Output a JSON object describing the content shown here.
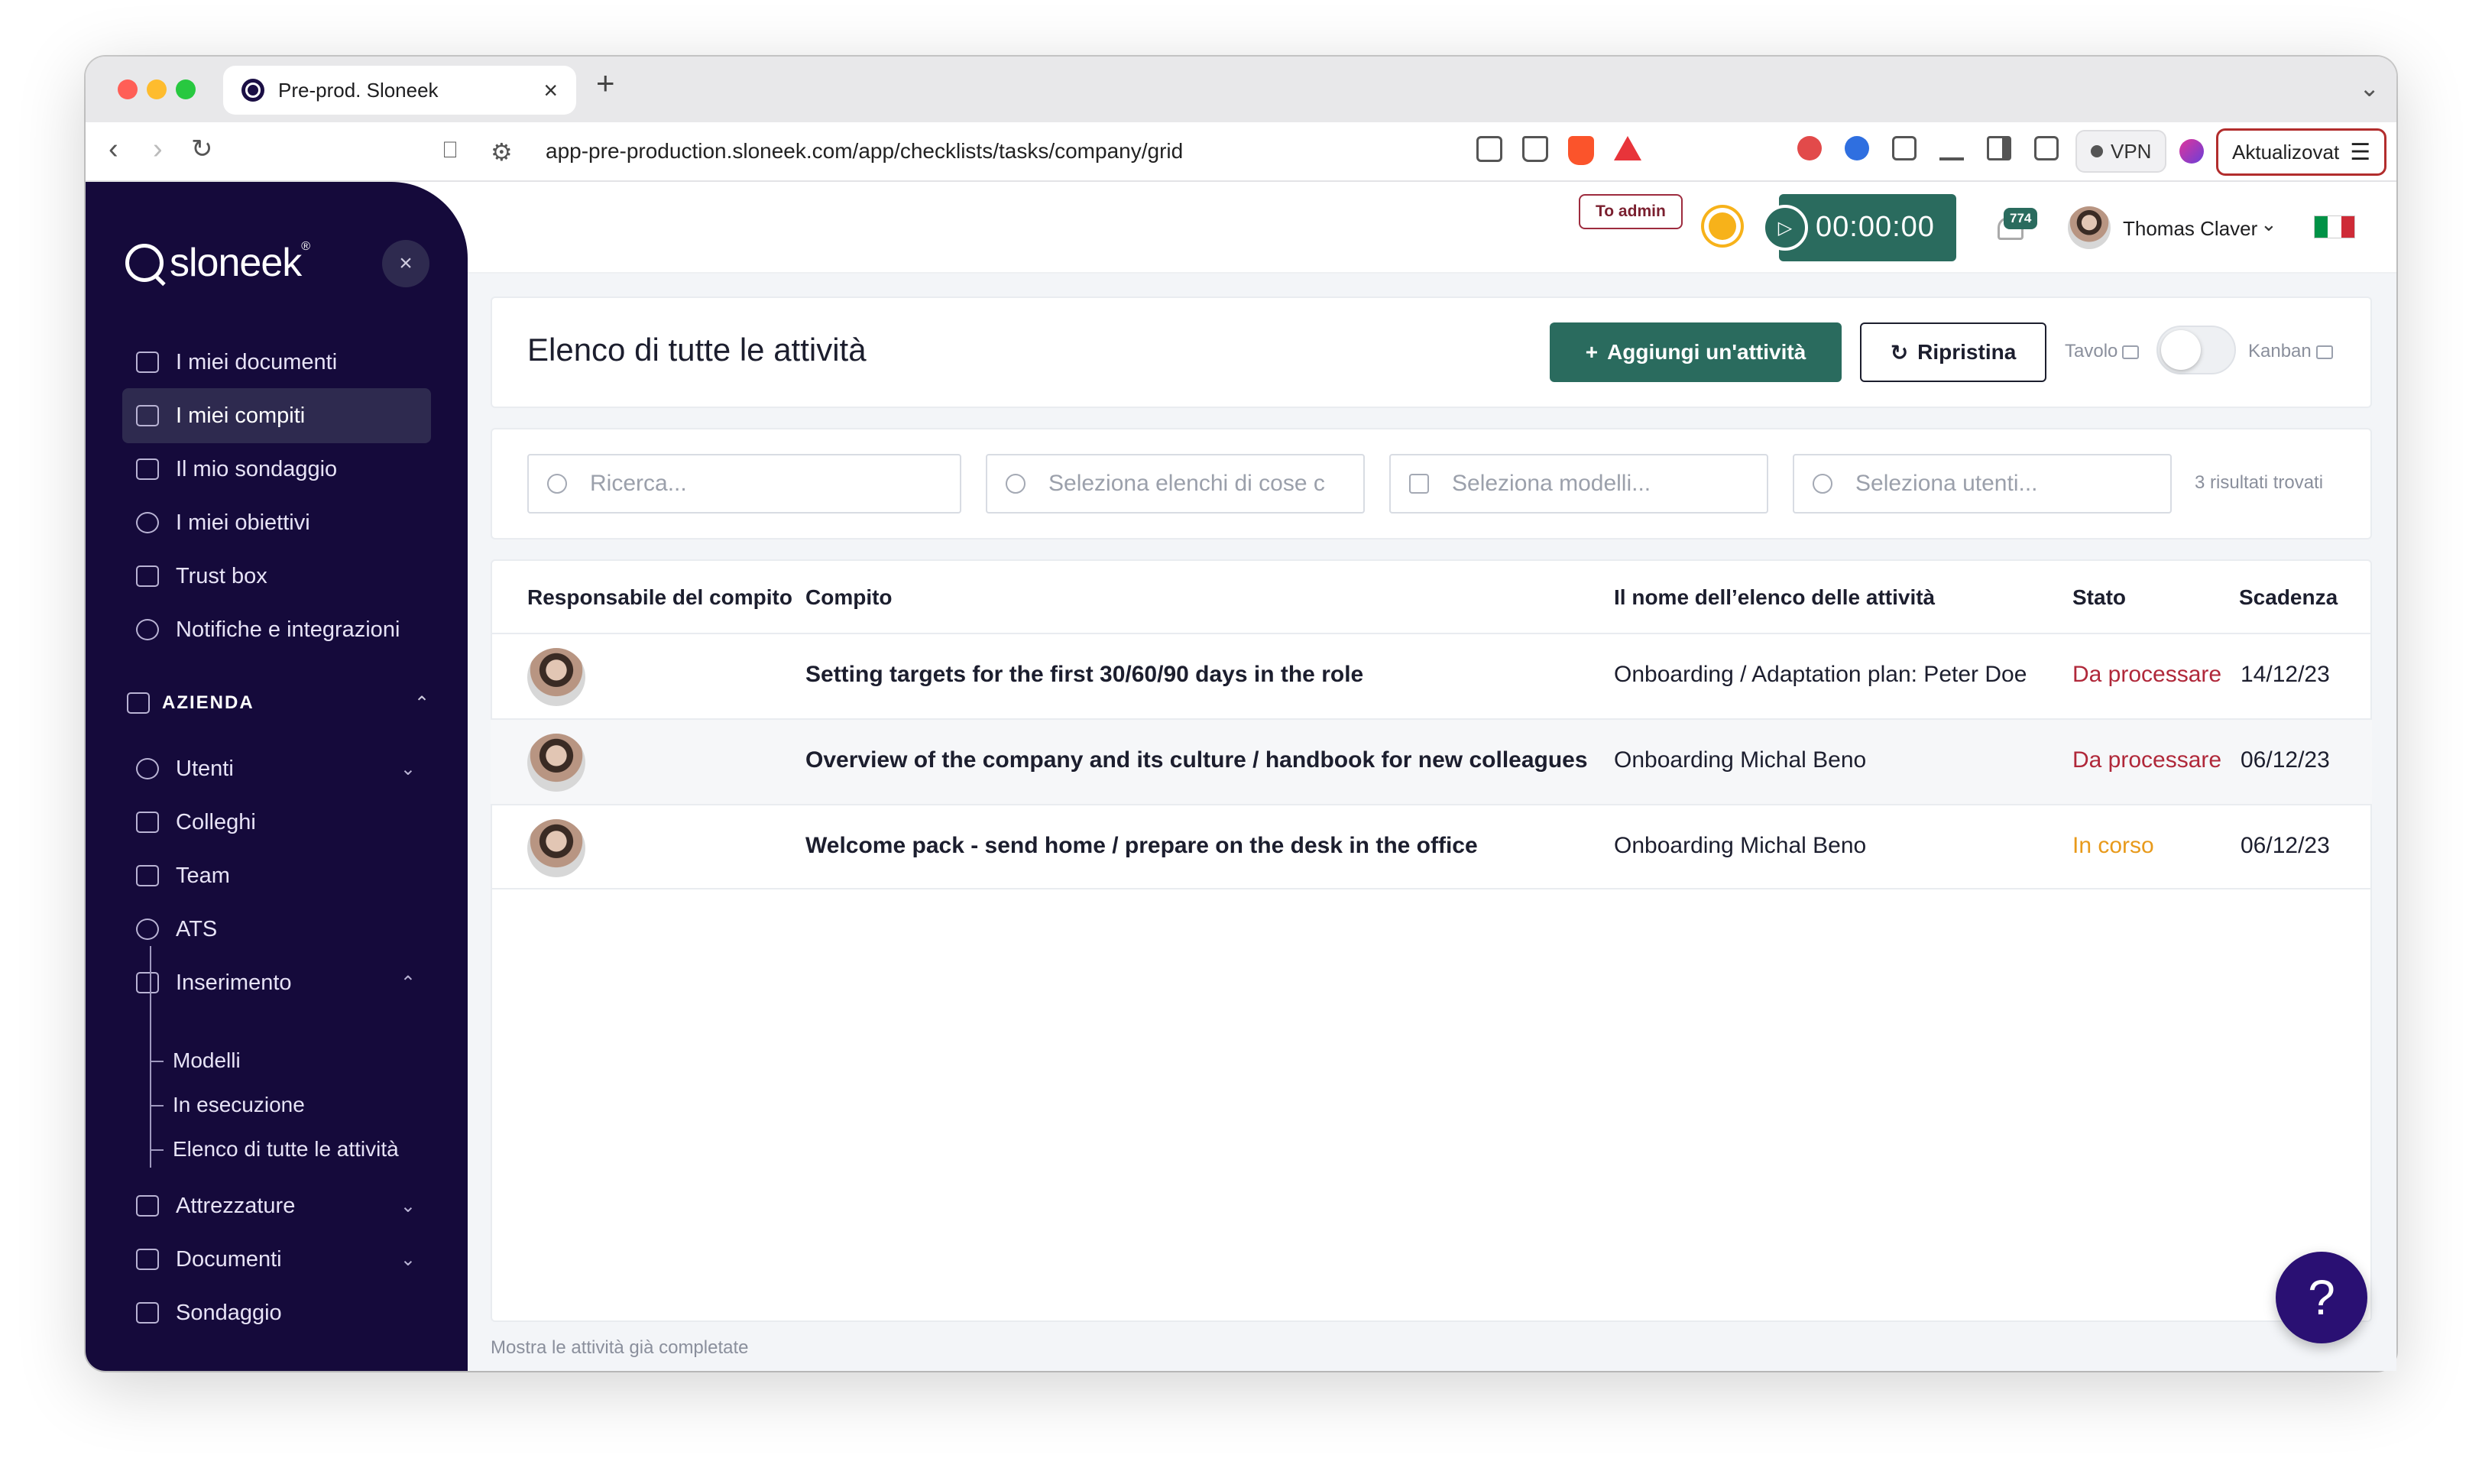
{
  "browser": {
    "tab_title": "Pre-prod. Sloneek",
    "url": "app-pre-production.sloneek.com/app/checklists/tasks/company/grid",
    "vpn_label": "VPN",
    "update_label": "Aktualizovat"
  },
  "sidebar": {
    "logo_text": "sloneek",
    "logo_mark": "®",
    "close_icon": "×",
    "items": [
      {
        "label": "I miei documenti",
        "icon": "folder-icon"
      },
      {
        "label": "I miei compiti",
        "icon": "checklist-icon",
        "active": true
      },
      {
        "label": "Il mio sondaggio",
        "icon": "survey-icon"
      },
      {
        "label": "I miei obiettivi",
        "icon": "target-icon"
      },
      {
        "label": "Trust box",
        "icon": "trust-box-icon"
      },
      {
        "label": "Notifiche e integrazioni",
        "icon": "gear-icon"
      }
    ],
    "section_label": "AZIENDA",
    "company_items": [
      {
        "label": "Utenti",
        "icon": "users-icon"
      },
      {
        "label": "Colleghi",
        "icon": "colleagues-icon"
      },
      {
        "label": "Team",
        "icon": "team-icon"
      },
      {
        "label": "ATS",
        "icon": "add-person-icon"
      },
      {
        "label": "Inserimento",
        "icon": "checklist-icon"
      }
    ],
    "sub_items": [
      "Modelli",
      "In esecuzione",
      "Elenco di tutte le attività"
    ],
    "bottom_items": [
      {
        "label": "Attrezzature",
        "icon": "tools-icon"
      },
      {
        "label": "Documenti",
        "icon": "folder-icon"
      },
      {
        "label": "Sondaggio",
        "icon": "survey-icon"
      }
    ]
  },
  "header": {
    "to_admin": "To admin",
    "timer": "00:00:00",
    "notifications_count": "774",
    "user_name": "Thomas Claver",
    "flag_colors": [
      "#009246",
      "#ffffff",
      "#ce2b37"
    ]
  },
  "page": {
    "title": "Elenco di tutte le attività",
    "add_button": "Aggiungi un'attività",
    "reset_button": "Ripristina",
    "view_table": "Tavolo",
    "view_kanban": "Kanban"
  },
  "filters": {
    "search_placeholder": "Ricerca...",
    "lists_placeholder": "Seleziona elenchi di cose c",
    "models_placeholder": "Seleziona modelli...",
    "users_placeholder": "Seleziona utenti...",
    "results": "3 risultati trovati"
  },
  "table": {
    "headers": [
      "Responsabile del compito",
      "Compito",
      "Il nome dell’elenco delle attività",
      "Stato",
      "Scadenza"
    ],
    "rows": [
      {
        "task": "Setting targets for the first 30/60/90 days in the role",
        "list": "Onboarding / Adaptation plan: Peter Doe",
        "status": "Da processare",
        "due": "14/12/23"
      },
      {
        "task": "Overview of the company and its culture / handbook for new colleagues",
        "list": "Onboarding Michal Beno",
        "status": "Da processare",
        "due": "06/12/23"
      },
      {
        "task": "Welcome pack - send home / prepare on the desk in the office",
        "list": "Onboarding Michal Beno",
        "status": "In corso",
        "due": "06/12/23"
      }
    ]
  },
  "footer": {
    "completed_link": "Mostra le attività già completate",
    "help": "?"
  },
  "colors": {
    "sidebar_bg": "#150a3b",
    "primary_green": "#2a6b5e",
    "status_todo": "#b0283a",
    "status_in_progress": "#e89a1b",
    "help_bg": "#2a1073"
  }
}
